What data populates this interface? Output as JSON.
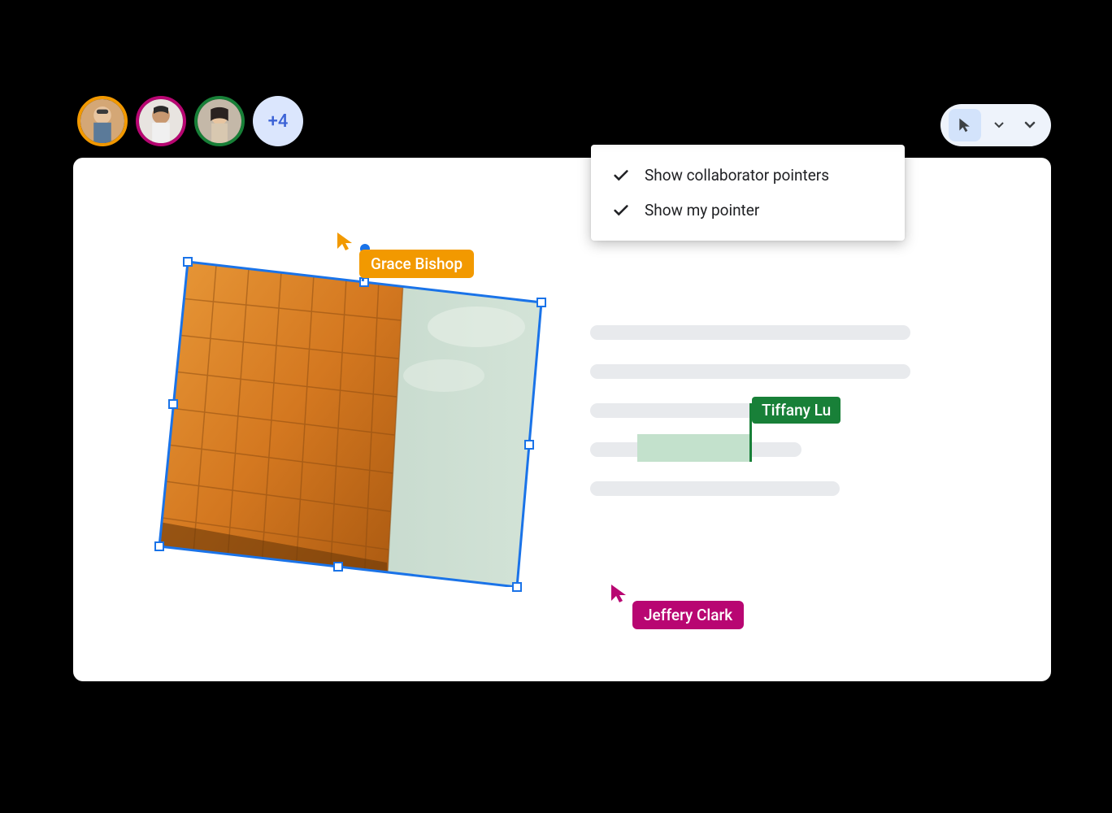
{
  "avatars": {
    "overflow_label": "+4",
    "items": [
      {
        "border_color": "#f29900"
      },
      {
        "border_color": "#b80672"
      },
      {
        "border_color": "#188038"
      }
    ]
  },
  "dropdown": {
    "items": [
      {
        "label": "Show collaborator pointers",
        "checked": true
      },
      {
        "label": "Show my pointer",
        "checked": true
      }
    ]
  },
  "collaborators": {
    "grace": {
      "label": "Grace Bishop",
      "color": "#f29900"
    },
    "tiffany": {
      "label": "Tiffany Lu",
      "color": "#188038"
    },
    "jeffery": {
      "label": "Jeffery Clark",
      "color": "#b80672"
    }
  }
}
